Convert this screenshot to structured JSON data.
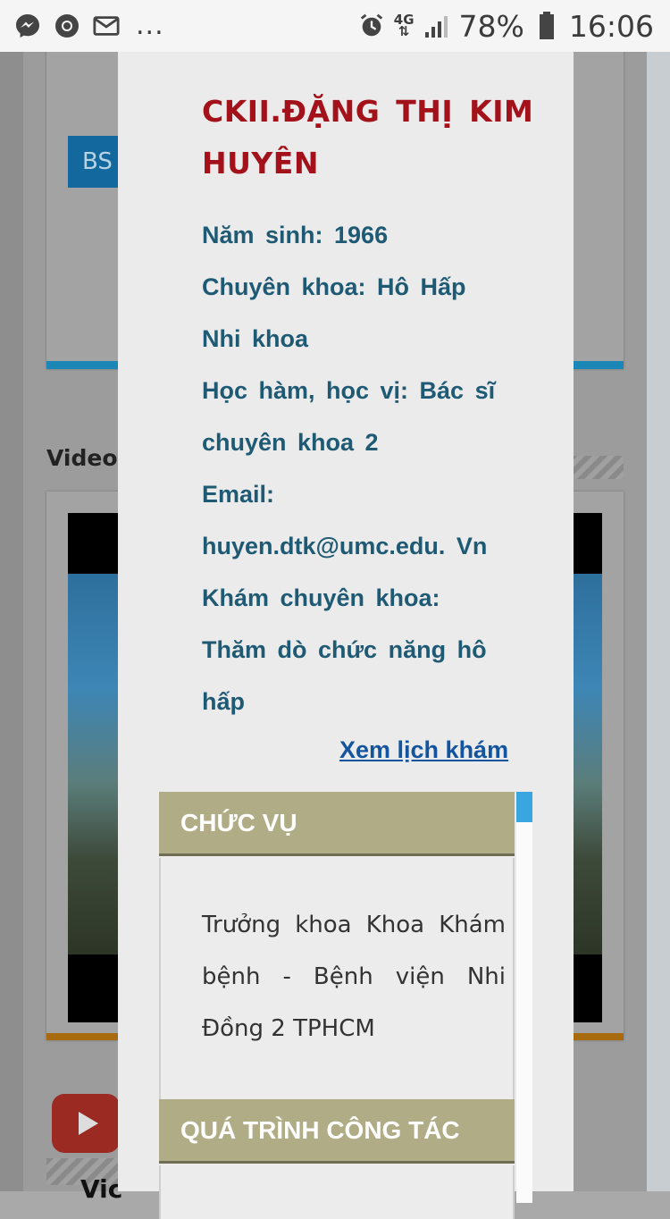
{
  "status_bar": {
    "notification_icons": [
      "messenger-icon",
      "chrome-icon",
      "mail-icon"
    ],
    "overflow": "...",
    "network": "4G",
    "battery": "78%",
    "time": "16:06"
  },
  "background": {
    "badge_text": "BS",
    "video_section_title": "Video",
    "bottom_text": "Vic"
  },
  "doctor": {
    "name": "CKII.ĐẶNG THỊ KIM HUYÊN",
    "lines": [
      "Năm sinh: 1966",
      "Chuyên khoa: Hô Hấp",
      "Nhi khoa",
      "Học hàm, học vị: Bác sĩ",
      "chuyên khoa 2",
      "Email:",
      "huyen.dtk@umc.edu. Vn",
      "Khám chuyên khoa:",
      "Thăm dò chức năng hô",
      "hấp"
    ],
    "schedule_link": "Xem lịch khám"
  },
  "sections": {
    "position_title": "CHỨC VỤ",
    "position_text": "Trưởng khoa Khoa Khám bệnh - Bệnh viện Nhi Đồng 2 TPHCM",
    "career_title": "QUÁ TRÌNH CÔNG TÁC"
  },
  "colors": {
    "name": "#a3111a",
    "info_text": "#1f5a74",
    "link": "#12549d",
    "section_header": "#b0ad86",
    "scroll_thumb": "#39a6df"
  }
}
